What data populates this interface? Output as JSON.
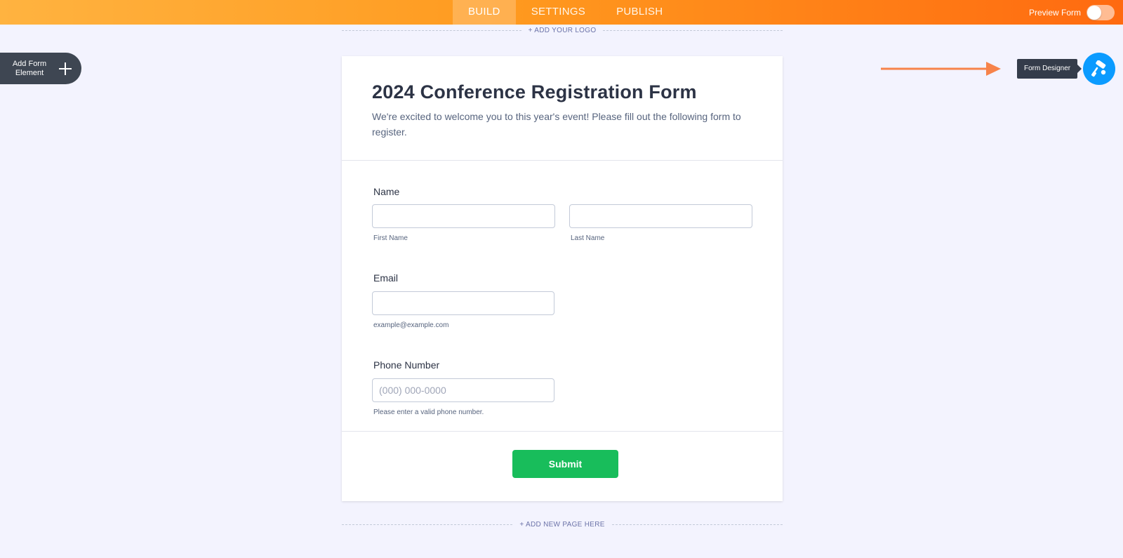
{
  "topbar": {
    "tabs": [
      {
        "label": "BUILD",
        "active": true
      },
      {
        "label": "SETTINGS",
        "active": false
      },
      {
        "label": "PUBLISH",
        "active": false
      }
    ],
    "preview_label": "Preview Form",
    "preview_enabled": false
  },
  "canvas": {
    "add_logo": "+ ADD YOUR LOGO",
    "add_page": "+ ADD NEW PAGE HERE"
  },
  "sidebar": {
    "add_element_line1": "Add Form",
    "add_element_line2": "Element"
  },
  "designer": {
    "tooltip": "Form Designer",
    "icon": "paint-roller-icon",
    "color": "#0b9bff"
  },
  "form": {
    "title": "2024 Conference Registration Form",
    "description": "We're excited to welcome you to this year's event! Please fill out the following form to register.",
    "name": {
      "label": "Name",
      "first_sublabel": "First Name",
      "last_sublabel": "Last Name",
      "first_value": "",
      "last_value": ""
    },
    "email": {
      "label": "Email",
      "value": "",
      "sublabel": "example@example.com"
    },
    "phone": {
      "label": "Phone Number",
      "placeholder": "(000) 000-0000",
      "sublabel": "Please enter a valid phone number."
    },
    "submit_label": "Submit",
    "submit_color": "#18bd5b"
  },
  "colors": {
    "topbar_start": "#ffb340",
    "topbar_end": "#ff6a10",
    "arrow": "#f7834a",
    "background": "#f3f3fe"
  }
}
